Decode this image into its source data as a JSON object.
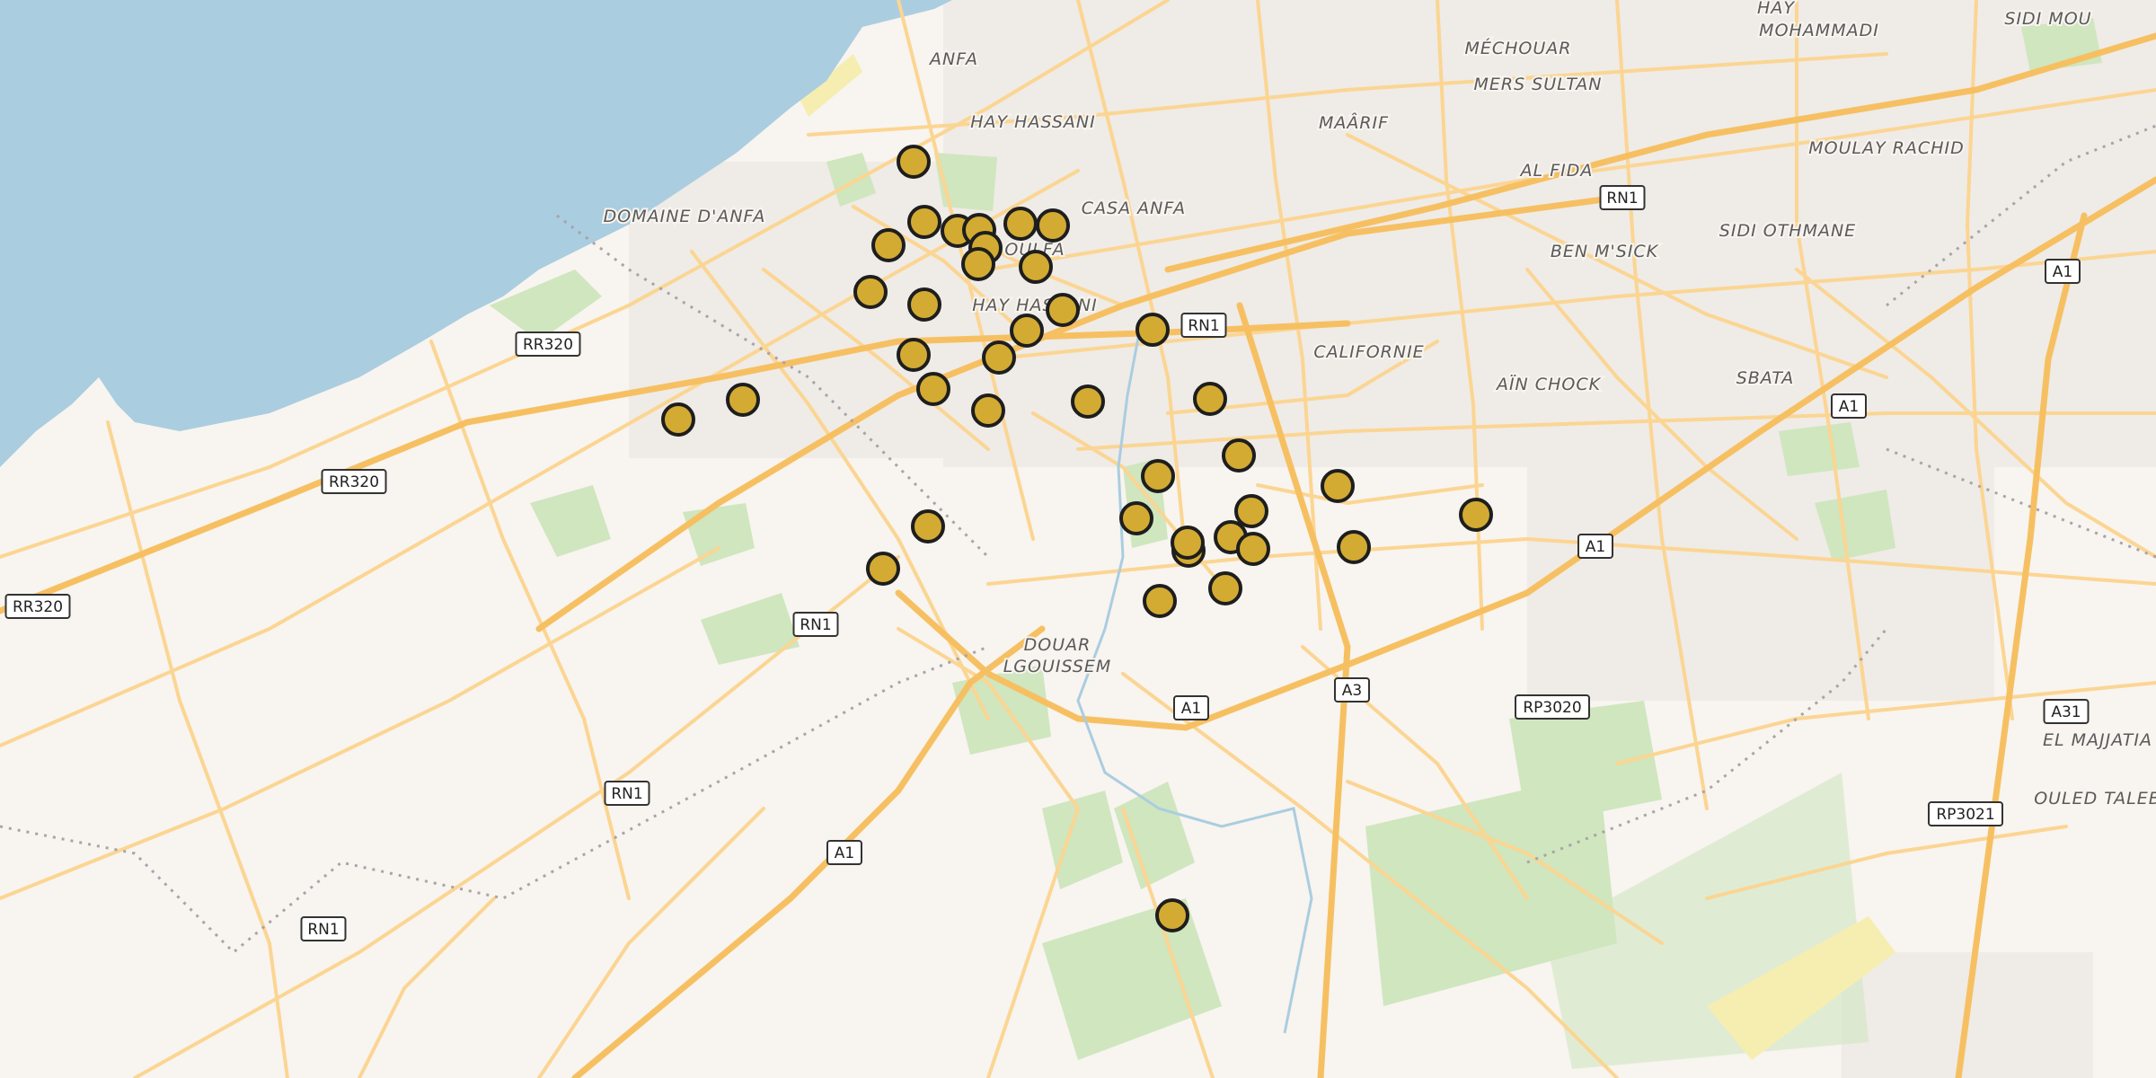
{
  "map": {
    "colors": {
      "sea": "#aacde0",
      "land": "#f8f4ef",
      "road_major": "#f6c062",
      "road_minor": "#fbd592",
      "park": "#cfe6bf",
      "marker_fill": "#d3ab33",
      "marker_stroke": "#1e1e1e"
    },
    "area_labels": [
      {
        "text": "ANFA"
      },
      {
        "text": "HAY HASSANI"
      },
      {
        "text": "MÉCHOUAR"
      },
      {
        "text": "HAY"
      },
      {
        "text": "MOHAMMADI"
      },
      {
        "text": "SIDI MOU"
      },
      {
        "text": "MERS SULTAN"
      },
      {
        "text": "MAÂRIF"
      },
      {
        "text": "MOULAY RACHID"
      },
      {
        "text": "AL FIDA"
      },
      {
        "text": "CASA ANFA"
      },
      {
        "text": "DOMAINE D'ANFA"
      },
      {
        "text": "OULFA"
      },
      {
        "text": "SIDI OTHMANE"
      },
      {
        "text": "BEN M'SICK"
      },
      {
        "text": "HAY HASSANI"
      },
      {
        "text": "CALIFORNIE"
      },
      {
        "text": "AÏN CHOCK"
      },
      {
        "text": "SBATA"
      },
      {
        "text": "DOUAR"
      },
      {
        "text": "LGOUISSEM"
      },
      {
        "text": "EL MAJJATIA"
      },
      {
        "text": "OULED TALEB"
      }
    ],
    "road_shields": [
      {
        "text": "RN1"
      },
      {
        "text": "RN1"
      },
      {
        "text": "RR320"
      },
      {
        "text": "RR320"
      },
      {
        "text": "RR320"
      },
      {
        "text": "A1"
      },
      {
        "text": "A1"
      },
      {
        "text": "A1"
      },
      {
        "text": "RN1"
      },
      {
        "text": "A1"
      },
      {
        "text": "A3"
      },
      {
        "text": "RP3020"
      },
      {
        "text": "RN1"
      },
      {
        "text": "A1"
      },
      {
        "text": "A31"
      },
      {
        "text": "RP3021"
      },
      {
        "text": "RN1"
      }
    ],
    "markers_count_note": ""
  }
}
